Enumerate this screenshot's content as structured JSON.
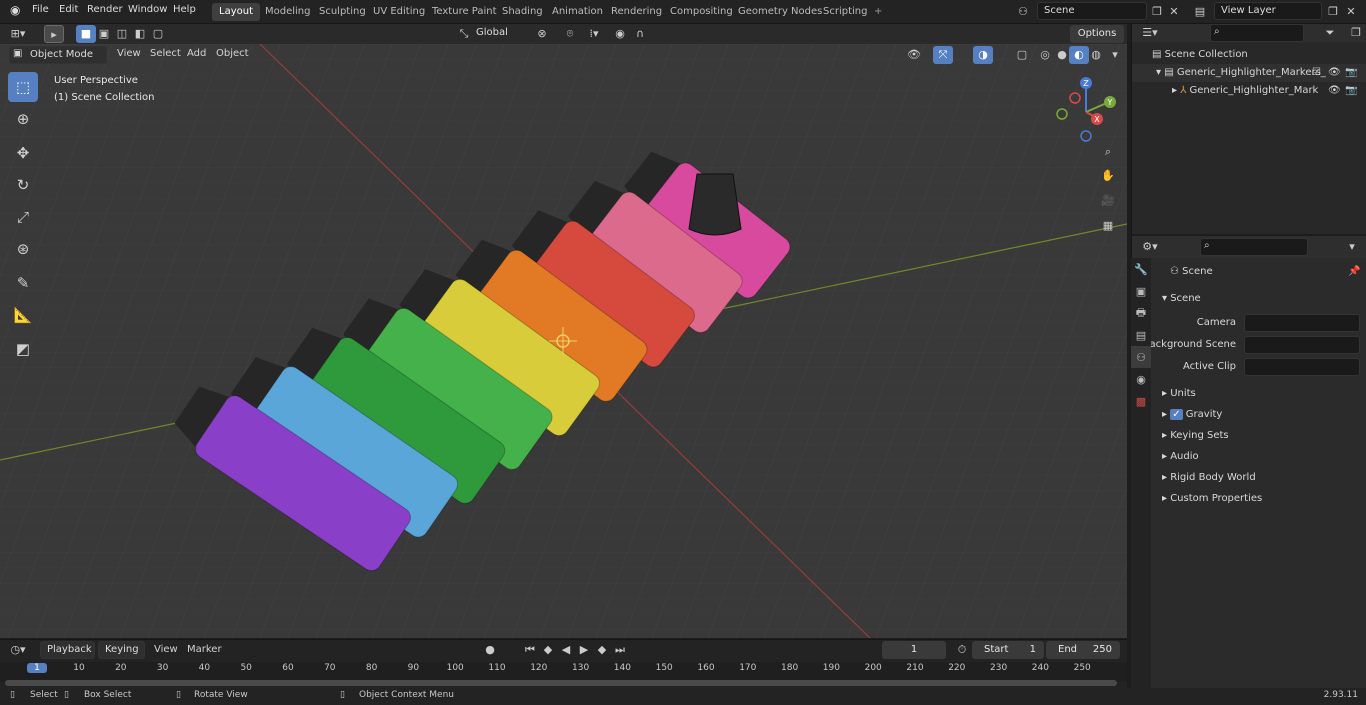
{
  "topbar": {
    "menus": [
      "File",
      "Edit",
      "Render",
      "Window",
      "Help"
    ],
    "workspaces": [
      "Layout",
      "Modeling",
      "Sculpting",
      "UV Editing",
      "Texture Paint",
      "Shading",
      "Animation",
      "Rendering",
      "Compositing",
      "Geometry Nodes",
      "Scripting"
    ],
    "active_workspace": "Layout",
    "add_workspace": "+",
    "scene_name": "Scene",
    "view_layer": "View Layer"
  },
  "tool_header": {
    "transform_orientation": "Global",
    "options": "Options"
  },
  "viewport_header": {
    "mode": "Object Mode",
    "menus": [
      "View",
      "Select",
      "Add",
      "Object"
    ]
  },
  "viewport": {
    "perspective_label": "User Perspective",
    "collection_label": "(1) Scene Collection",
    "gizmo_axes": {
      "z": "Z",
      "y": "Y",
      "x": "X"
    }
  },
  "left_tools": [
    "select-box-tool",
    "cursor-tool",
    "move-tool",
    "rotate-tool",
    "scale-tool",
    "transform-tool",
    "annotate-tool",
    "measure-tool",
    "add-cube-tool"
  ],
  "outliner": {
    "root": "Scene Collection",
    "items": [
      {
        "name": "Generic_Highlighter_Markers_"
      },
      {
        "name": "Generic_Highlighter_Mark"
      }
    ]
  },
  "properties": {
    "header": "Scene",
    "section": "Scene",
    "fields": [
      {
        "label": "Camera",
        "value": ""
      },
      {
        "label": "Background Scene",
        "value": ""
      },
      {
        "label": "Active Clip",
        "value": ""
      }
    ],
    "panels": [
      "Units",
      "Gravity",
      "Keying Sets",
      "Audio",
      "Rigid Body World",
      "Custom Properties"
    ],
    "gravity_checked": true
  },
  "timeline": {
    "menus": [
      "Playback",
      "Keying",
      "View",
      "Marker"
    ],
    "current_frame": "1",
    "start_label": "Start",
    "start": "1",
    "end_label": "End",
    "end": "250",
    "ticks": [
      "1",
      "10",
      "20",
      "30",
      "40",
      "50",
      "60",
      "70",
      "80",
      "90",
      "100",
      "110",
      "120",
      "130",
      "140",
      "150",
      "160",
      "170",
      "180",
      "190",
      "200",
      "210",
      "220",
      "230",
      "240",
      "250"
    ]
  },
  "statusbar": {
    "select": "Select",
    "box_select": "Box Select",
    "rotate_view": "Rotate View",
    "context_menu": "Object Context Menu",
    "version": "2.93.11"
  },
  "colors": {
    "accent": "#5680c2",
    "viewport_bg": "#393939",
    "markers": [
      "#8a3fc8",
      "#5aa6d8",
      "#2f9a3c",
      "#45b14a",
      "#d8cc3a",
      "#e27a25",
      "#d64a3e",
      "#dc6a8c",
      "#d84a9e"
    ]
  }
}
